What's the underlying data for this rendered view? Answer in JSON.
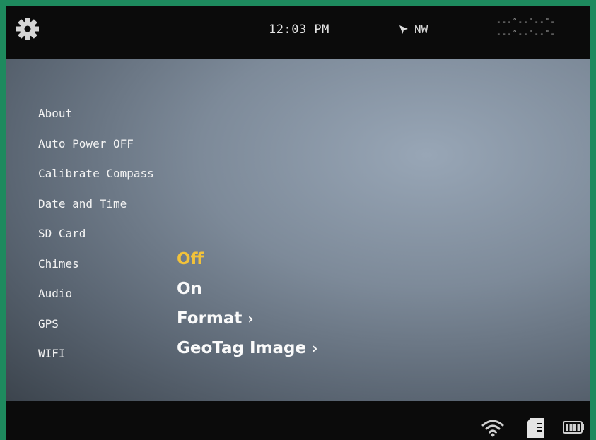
{
  "status_bar": {
    "settings_icon": "gear-icon",
    "time": "12:03 PM",
    "heading": "NW",
    "heading_icon": "arrow-pointer-icon",
    "coords_line1": "---°--'--\"-",
    "coords_line2": "---°--'--\"-"
  },
  "menu": {
    "items": [
      {
        "label": "About"
      },
      {
        "label": "Auto Power OFF"
      },
      {
        "label": "Calibrate Compass"
      },
      {
        "label": "Date and Time"
      },
      {
        "label": "SD Card"
      },
      {
        "label": "Chimes"
      },
      {
        "label": "Audio"
      },
      {
        "label": "GPS"
      },
      {
        "label": "WIFI"
      }
    ]
  },
  "options": {
    "chimes": "Off",
    "audio": "On",
    "gps": "Format",
    "wifi": "GeoTag Image",
    "chevron": "›"
  },
  "colors": {
    "selected": "#f2c23a",
    "frame": "#1e8a5e"
  },
  "footer": {
    "icons": [
      "wifi-icon",
      "sd-card-icon",
      "battery-icon"
    ]
  }
}
